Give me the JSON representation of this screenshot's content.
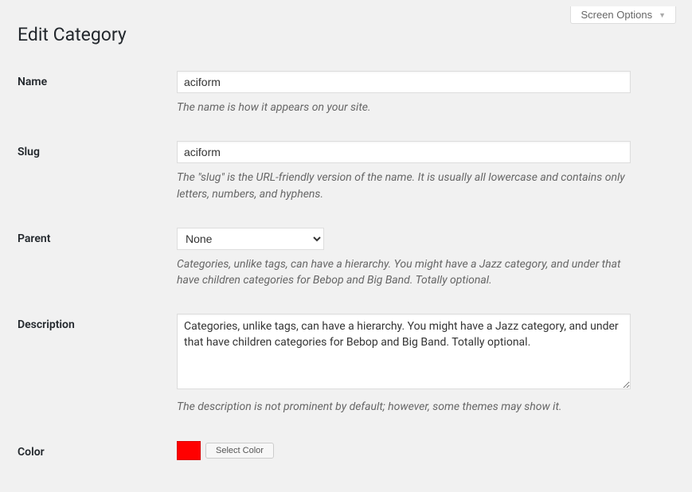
{
  "screen_options": {
    "label": "Screen Options"
  },
  "page_title": "Edit Category",
  "fields": {
    "name": {
      "label": "Name",
      "value": "aciform",
      "description": "The name is how it appears on your site."
    },
    "slug": {
      "label": "Slug",
      "value": "aciform",
      "description": "The \"slug\" is the URL-friendly version of the name. It is usually all lowercase and contains only letters, numbers, and hyphens."
    },
    "parent": {
      "label": "Parent",
      "selected": "None",
      "description": "Categories, unlike tags, can have a hierarchy. You might have a Jazz category, and under that have children categories for Bebop and Big Band. Totally optional."
    },
    "description": {
      "label": "Description",
      "value": "Categories, unlike tags, can have a hierarchy. You might have a Jazz category, and under that have children categories for Bebop and Big Band. Totally optional.",
      "description": "The description is not prominent by default; however, some themes may show it."
    },
    "color": {
      "label": "Color",
      "swatch": "#ff0000",
      "button": "Select Color"
    }
  }
}
